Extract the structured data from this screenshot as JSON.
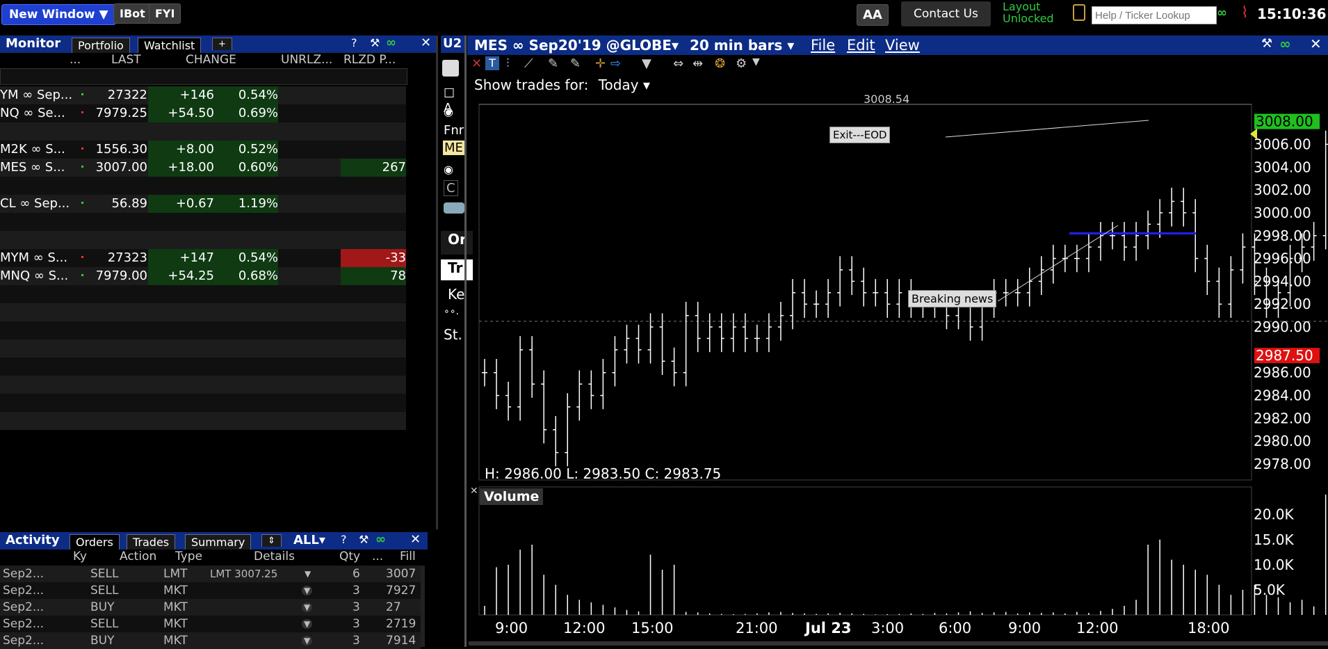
{
  "topbar": {
    "new_window": "New Window ▼",
    "ibot": "IBot",
    "fyi": "FYI",
    "aa": "AA",
    "contact": "Contact Us",
    "layout_line1": "Layout",
    "layout_line2": "Unlocked",
    "search_placeholder": "Help / Ticker Lookup",
    "time": "15:10:36"
  },
  "monitor": {
    "title": "Monitor",
    "tabs": [
      "Portfolio",
      "Watchlist",
      "+"
    ],
    "columns": [
      "...",
      "LAST",
      "CHANGE",
      "UNRLZ...",
      "RLZD P..."
    ],
    "rows": [
      {
        "sym": "YM ∞ Sep...",
        "last": "27322",
        "chg": "+146",
        "pct": "0.54%",
        "unr": "",
        "rlzd": ""
      },
      {
        "sym": "NQ ∞ Se...",
        "last": "7979.25",
        "chg": "+54.50",
        "pct": "0.69%",
        "unr": "",
        "rlzd": ""
      },
      {
        "sym": "",
        "last": "",
        "chg": "",
        "pct": "",
        "unr": "",
        "rlzd": ""
      },
      {
        "sym": "M2K ∞ S...",
        "last": "1556.30",
        "chg": "+8.00",
        "pct": "0.52%",
        "unr": "",
        "rlzd": ""
      },
      {
        "sym": "MES ∞ S...",
        "last": "3007.00",
        "chg": "+18.00",
        "pct": "0.60%",
        "unr": "",
        "rlzd": "267"
      },
      {
        "sym": "",
        "last": "",
        "chg": "",
        "pct": "",
        "unr": "",
        "rlzd": ""
      },
      {
        "sym": "CL ∞ Sep...",
        "last": "56.89",
        "chg": "+0.67",
        "pct": "1.19%",
        "unr": "",
        "rlzd": ""
      },
      {
        "sym": "",
        "last": "",
        "chg": "",
        "pct": "",
        "unr": "",
        "rlzd": ""
      },
      {
        "sym": "",
        "last": "",
        "chg": "",
        "pct": "",
        "unr": "",
        "rlzd": ""
      },
      {
        "sym": "MYM ∞ S...",
        "last": "27323",
        "chg": "+147",
        "pct": "0.54%",
        "unr": "",
        "rlzd": "-33"
      },
      {
        "sym": "MNQ ∞ S...",
        "last": "7979.00",
        "chg": "+54.25",
        "pct": "0.68%",
        "unr": "",
        "rlzd": "78"
      }
    ]
  },
  "activity": {
    "title": "Activity",
    "tabs": [
      "Orders",
      "Trades",
      "Summary",
      "⇕"
    ],
    "filter": "ALL▾",
    "columns": [
      "Ky",
      "Action",
      "Type",
      "Details",
      "Qty",
      "...",
      "Fill"
    ],
    "rows": [
      {
        "ky": "Sep2...",
        "action": "SELL",
        "type": "LMT",
        "details": "LMT 3007.25",
        "qty": "6",
        "fill": "3007"
      },
      {
        "ky": "Sep2...",
        "action": "SELL",
        "type": "MKT",
        "details": "",
        "qty": "3",
        "fill": "7927"
      },
      {
        "ky": "Sep2...",
        "action": "BUY",
        "type": "MKT",
        "details": "",
        "qty": "3",
        "fill": "27"
      },
      {
        "ky": "Sep2...",
        "action": "SELL",
        "type": "MKT",
        "details": "",
        "qty": "3",
        "fill": "2719"
      },
      {
        "ky": "Sep2...",
        "action": "BUY",
        "type": "MKT",
        "details": "",
        "qty": "3",
        "fill": "7914"
      }
    ]
  },
  "middle": {
    "header": "U2",
    "a": "A",
    "fn": "Fnr",
    "me": "ME",
    "c": "C",
    "or": "Or",
    "tr": "Tr",
    "ke": "Ke",
    "oo": "∘∘.",
    "st": "St."
  },
  "chart": {
    "title": "MES ∞ Sep20'19 @GLOBE▾",
    "bars": "20 min bars ▾",
    "menus": [
      "File",
      "Edit",
      "View"
    ],
    "show_trades_label": "Show trades for:",
    "show_trades_value": "Today ▾",
    "top_price_label": "3008.54",
    "ohlc": "H: 2986.00  L: 2983.50  C: 2983.75",
    "volume_title": "Volume",
    "annotations": [
      "Exit---EOD",
      "Breaking news"
    ],
    "price_ticks": [
      "3006.00",
      "3004.00",
      "3002.00",
      "3000.00",
      "2998.00",
      "2996.00",
      "2994.00",
      "2992.00",
      "2990.00",
      "2986.00",
      "2984.00",
      "2982.00",
      "2980.00",
      "2978.00"
    ],
    "price_tag_green": "3008.00",
    "price_tag_yellow": "3007.00",
    "price_tag_red": "2987.50",
    "volume_ticks": [
      "20.0K",
      "15.0K",
      "10.0K",
      "5.0K"
    ],
    "time_ticks": [
      "9:00",
      "12:00",
      "15:00",
      "21:00",
      "Jul 23",
      "3:00",
      "6:00",
      "9:00",
      "12:00",
      "18:00"
    ]
  },
  "chart_data": {
    "type": "bar",
    "title": "MES ∞ Sep20'19 @GLOBE",
    "xlabel": "",
    "ylabel": "",
    "ylim": [
      2977,
      3010
    ],
    "closes": [
      2986,
      2984,
      2983,
      2988,
      2985,
      2981,
      2979,
      2983,
      2985,
      2984,
      2986,
      2988,
      2989,
      2988,
      2990,
      2987,
      2986,
      2991,
      2989,
      2990,
      2989,
      2990,
      2989,
      2989,
      2990,
      2991,
      2993,
      2992,
      2992,
      2993,
      2995,
      2994,
      2993,
      2993,
      2992,
      2993,
      2992,
      2992,
      2992,
      2991,
      2992,
      2990,
      2992,
      2993,
      2993,
      2993,
      2994,
      2995,
      2996,
      2996,
      2996,
      2997,
      2998,
      2998,
      2997,
      2998,
      2999,
      3000,
      3001,
      3000,
      2996,
      2994,
      2992,
      2995,
      2997,
      2994,
      2992,
      2993,
      2996,
      2997,
      2998,
      3006,
      3005,
      3003,
      3004,
      3005,
      3006,
      3007,
      3008,
      3007
    ],
    "volume": [
      1800,
      9500,
      10000,
      13000,
      14000,
      8000,
      6000,
      4000,
      3000,
      2500,
      2000,
      1500,
      1000,
      700,
      12000,
      9000,
      10000,
      600,
      500,
      300,
      200,
      150,
      200,
      300,
      500,
      600,
      400,
      300,
      200,
      300,
      400,
      300,
      200,
      100,
      150,
      200,
      300,
      200,
      400,
      300,
      500,
      700,
      400,
      500,
      600,
      300,
      500,
      400,
      500,
      300,
      600,
      400,
      800,
      1200,
      1800,
      3000,
      14000,
      15000,
      11000,
      10000,
      9000,
      8000,
      6000,
      4000,
      5000,
      6000,
      4000,
      3500,
      2500,
      3000,
      1700,
      24000,
      5500,
      3500,
      3000,
      2500,
      3000,
      5500,
      8500,
      500
    ]
  }
}
